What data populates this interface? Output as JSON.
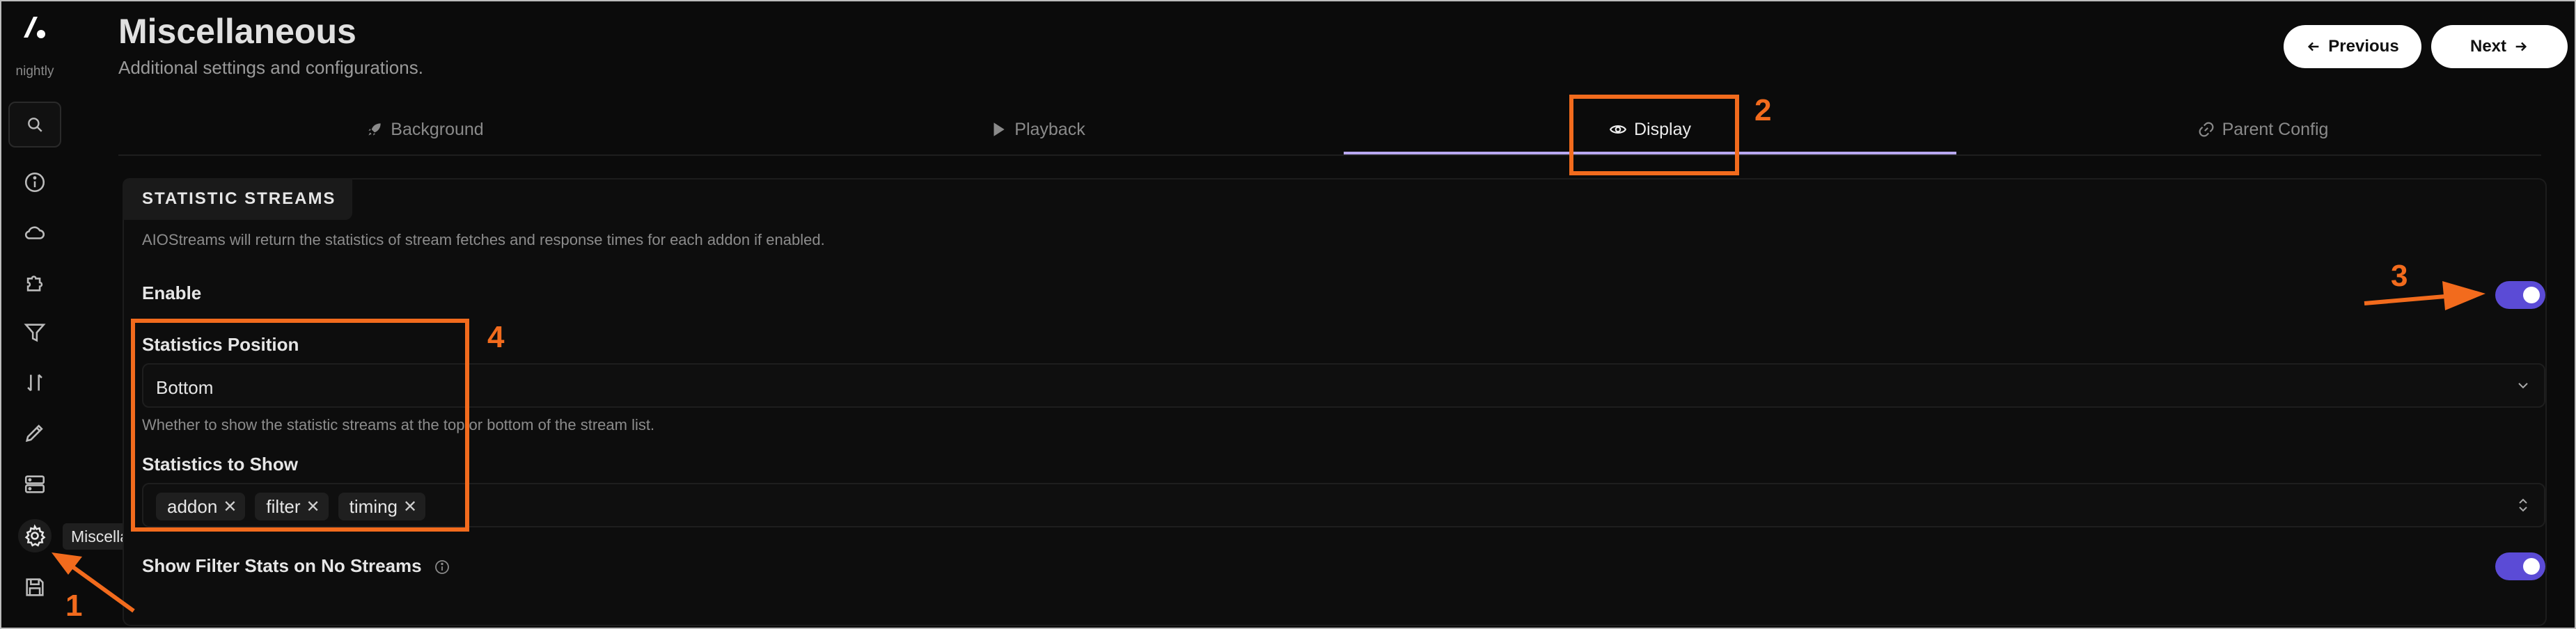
{
  "sidebar": {
    "nightly": "nightly",
    "tooltip": "Miscellaneous",
    "icons": [
      "search-icon",
      "info-icon",
      "cloud-icon",
      "puzzle-icon",
      "filter-icon",
      "sort-icon",
      "pen-icon",
      "server-icon",
      "gear-icon",
      "save-icon"
    ]
  },
  "header": {
    "title": "Miscellaneous",
    "subtitle": "Additional settings and configurations.",
    "prev_label": "Previous",
    "next_label": "Next"
  },
  "tabs": [
    {
      "label": "Background",
      "icon": "rocket-icon"
    },
    {
      "label": "Playback",
      "icon": "play-icon"
    },
    {
      "label": "Display",
      "icon": "eye-icon",
      "active": true
    },
    {
      "label": "Parent Config",
      "icon": "link-icon"
    }
  ],
  "section": {
    "title": "STATISTIC STREAMS",
    "description": "AIOStreams will return the statistics of stream fetches and response times for each addon if enabled.",
    "enable_label": "Enable",
    "enable_on": true,
    "position_label": "Statistics Position",
    "position_value": "Bottom",
    "position_hint": "Whether to show the statistic streams at the top or bottom of the stream list.",
    "show_label": "Statistics to Show",
    "show_chips": [
      "addon",
      "filter",
      "timing"
    ],
    "filter_stats_label": "Show Filter Stats on No Streams",
    "filter_stats_on": true
  },
  "annotations": [
    "1",
    "2",
    "3",
    "4"
  ],
  "colors": {
    "accent": "#5b4bd6",
    "annotation": "#f26b1d",
    "tab_underline": "#b8a8f0"
  }
}
